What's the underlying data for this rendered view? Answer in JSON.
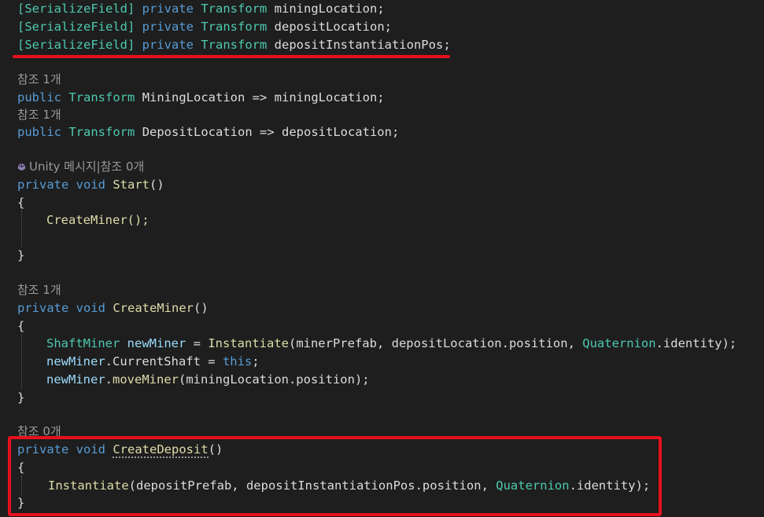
{
  "code": {
    "l1": {
      "attr": "[SerializeField]",
      "kw": "private",
      "type": "Transform",
      "name": "miningLocation",
      "end": ";"
    },
    "l2": {
      "attr": "[SerializeField]",
      "kw": "private",
      "type": "Transform",
      "name": "depositLocation",
      "end": ";"
    },
    "l3": {
      "attr": "[SerializeField]",
      "kw": "private",
      "type": "Transform",
      "name": "depositInstantiationPos",
      "end": ";"
    },
    "lens_ref1": "참조 1개",
    "l4": {
      "kw": "public",
      "type": "Transform",
      "rest": "MiningLocation => miningLocation;"
    },
    "lens_ref2": "참조 1개",
    "l5": {
      "kw": "public",
      "type": "Transform",
      "rest": "DepositLocation => depositLocation;"
    },
    "lens_unity": "Unity 메시지|참조 0개",
    "l6": {
      "kw1": "private",
      "kw2": "void",
      "fn": "Start",
      "paren": "()"
    },
    "open_brace": "{",
    "close_brace": "}",
    "l7": "CreateMiner();",
    "lens_ref3": "참조 1개",
    "l8": {
      "kw1": "private",
      "kw2": "void",
      "fn": "CreateMiner",
      "paren": "()"
    },
    "l9": {
      "type": "ShaftMiner",
      "local": "newMiner",
      "eq": " = ",
      "fn": "Instantiate",
      "args1": "(minerPrefab, depositLocation.position, ",
      "qtype": "Quaternion",
      "args2": ".identity);"
    },
    "l10": {
      "local": "newMiner",
      "rest": ".CurrentShaft = ",
      "kw": "this",
      "end": ";"
    },
    "l11": {
      "local": "newMiner",
      "dot": ".",
      "fn": "moveMiner",
      "rest": "(miningLocation.position);"
    },
    "lens_ref4": "참조 0개",
    "l12": {
      "kw1": "private",
      "kw2": "void",
      "fn": "CreateDeposit",
      "paren": "()"
    },
    "l13": {
      "fn": "Instantiate",
      "args1": "(depositPrefab, depositInstantiationPos.position, ",
      "qtype": "Quaternion",
      "args2": ".identity);"
    }
  },
  "colors": {
    "background": "#1e1e1e",
    "keyword": "#569cd6",
    "type": "#4ec9b0",
    "method": "#dcdcaa",
    "local": "#9cdcfe",
    "annotation_red": "#e8101e"
  }
}
